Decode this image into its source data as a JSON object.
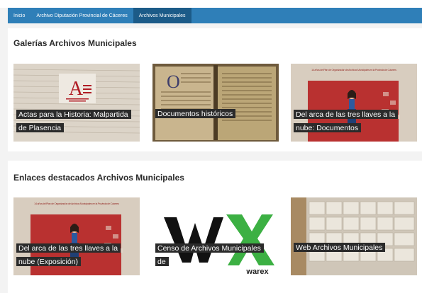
{
  "nav": {
    "items": [
      {
        "label": "Inicio"
      },
      {
        "label": "Archivo Diputación Provincial de Cáceres"
      },
      {
        "label": "Archivos Municipales"
      }
    ]
  },
  "galleries": {
    "title": "Galerías Archivos Municipales",
    "cards": [
      {
        "title": "Actas para la Historia: Malpartida de Plasencia"
      },
      {
        "title": "Documentos históricos"
      },
      {
        "title": "Del arca de las tres llaves a la nube: Documentos"
      }
    ]
  },
  "links": {
    "title": "Enlaces destacados Archivos Municipales",
    "cards": [
      {
        "title": "Del arca de las tres llaves a la nube (Exposición)"
      },
      {
        "title": "Censo de Archivos Municipales de"
      },
      {
        "title": "Web Archivos Municipales"
      }
    ]
  },
  "images": {
    "logo_letter": "A",
    "poster_header": "14 años del Plan de Organización de Archivos Municipales en la Provincia de Cáceres",
    "warex_logo_text": "warex"
  },
  "colors": {
    "nav_bg": "#2f7fb8",
    "nav_active": "#1c5b88",
    "caption_bg": "#2b2b2b",
    "logo_red": "#b01c24",
    "poster_red": "#b93130",
    "warex_green": "#3cb043"
  }
}
